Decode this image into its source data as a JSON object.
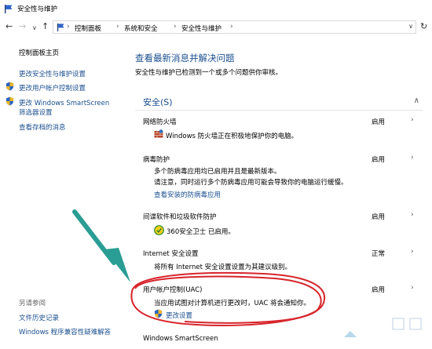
{
  "window": {
    "title": "安全性与维护"
  },
  "address_bar": {
    "back": "←",
    "forward": "→",
    "recent": "∨",
    "up": "↑",
    "crumbs": [
      "控制面板",
      "系统和安全",
      "安全性与维护"
    ],
    "separator": "›",
    "dropdown": "∨",
    "refresh": "↻"
  },
  "sidebar": {
    "home": "控制面板主页",
    "links": [
      "更改安全性与维护设置",
      "更改用户帐户控制设置",
      "更改 Windows SmartScreen",
      "筛选器设置",
      "查看存档的消息"
    ],
    "see_also": "另请参阅",
    "bottom_links": [
      "文件历史记录",
      "Windows 程序兼容性疑难解答"
    ]
  },
  "main": {
    "title": "查看最新消息并解决问题",
    "subtitle": "安全性与维护已检测到一个或多个问题供你审核。",
    "section": {
      "name": "安全(S)",
      "chevron": "∧"
    },
    "items": [
      {
        "title": "网络防火墙",
        "status": "启用",
        "desc1": "Windows 防火墙正在积极地保护你的电脑。"
      },
      {
        "title": "病毒防护",
        "status": "启用",
        "desc1": "多个防病毒应用均已启用并且是最新版本。",
        "desc2": "请注意，同时运行多个防病毒应用可能会导致你的电脑运行缓慢。",
        "link": "查看安装的防病毒应用"
      },
      {
        "title": "间谍软件和垃圾软件防护",
        "status": "启用",
        "desc1": "360安全卫士 已启用。"
      },
      {
        "title": "Internet 安全设置",
        "status": "正常",
        "desc1": "将所有 Internet 安全设置设置为其建议级别。"
      },
      {
        "title": "用户帐户控制(UAC)",
        "status": "启用",
        "desc1": "当应用试图对计算机进行更改时，UAC 将会通知你。",
        "link": "更改设置"
      },
      {
        "title": "Windows SmartScreen"
      }
    ],
    "chevron": "›"
  },
  "colors": {
    "link": "#1a4f8f",
    "annotation_arrow": "#2a9d94",
    "annotation_circle": "#d8242b"
  }
}
